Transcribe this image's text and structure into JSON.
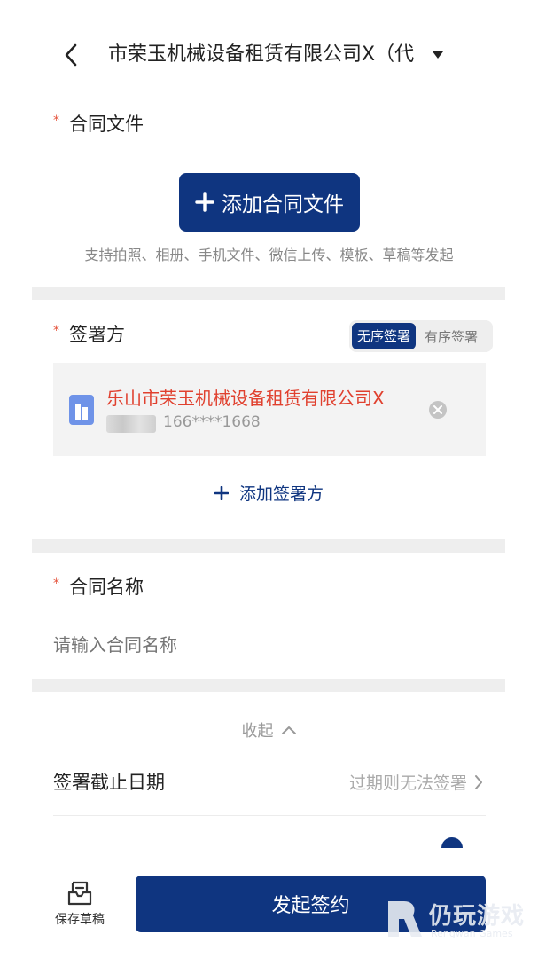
{
  "header": {
    "title": "市荣玉机械设备租赁有限公司X（代"
  },
  "contract_file": {
    "label": "合同文件",
    "required_mark": "*",
    "add_button": "添加合同文件",
    "hint": "支持拍照、相册、手机文件、微信上传、模板、草稿等发起"
  },
  "signers": {
    "label": "签署方",
    "required_mark": "*",
    "order_options": [
      "无序签署",
      "有序签署"
    ],
    "selected_order": "无序签署",
    "items": [
      {
        "name": "乐山市荣玉机械设备租赁有限公司X",
        "phone": "166****1668"
      }
    ],
    "add_button": "添加签署方"
  },
  "contract_name": {
    "label": "合同名称",
    "required_mark": "*",
    "placeholder": "请输入合同名称"
  },
  "collapse": {
    "label": "收起"
  },
  "deadline": {
    "label": "签署截止日期",
    "value": "过期则无法签署"
  },
  "bottom": {
    "draft_label": "保存草稿",
    "submit_label": "发起签约"
  },
  "watermark": {
    "text": "仍玩游戏",
    "sub": "Rengwan Games"
  },
  "colors": {
    "primary": "#0f3580",
    "required": "#e5533c",
    "signer_name": "#e0402e"
  }
}
